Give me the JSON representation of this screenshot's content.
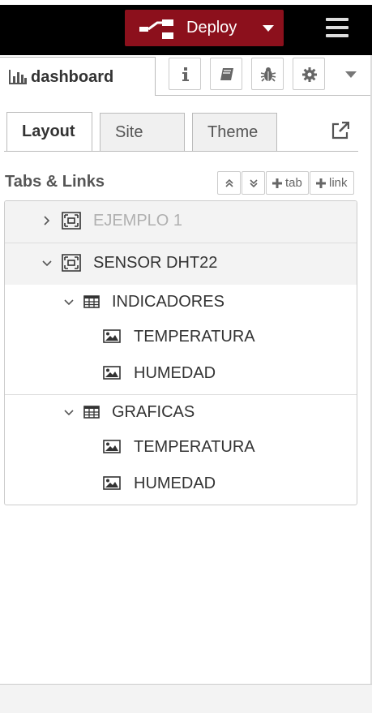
{
  "topbar": {
    "deploy_label": "Deploy",
    "icons": [
      "deploy-flow-icon",
      "chevron-down-icon",
      "menu-icon"
    ],
    "colors": {
      "background": "#000000",
      "deploy": "#8c101c"
    }
  },
  "sidebar_header": {
    "title": "dashboard",
    "icons": [
      "bar-chart-icon",
      "info-icon",
      "book-icon",
      "bug-icon",
      "gear-icon",
      "chevron-down-icon"
    ]
  },
  "tabs": [
    {
      "label": "Layout",
      "active": true
    },
    {
      "label": "Site",
      "active": false
    },
    {
      "label": "Theme",
      "active": false
    }
  ],
  "section": {
    "title": "Tabs & Links",
    "add_tab_label": "tab",
    "add_link_label": "link"
  },
  "tree": {
    "tabs": [
      {
        "label": "EJEMPLO 1",
        "collapsed": true,
        "disabled": true
      },
      {
        "label": "SENSOR DHT22",
        "collapsed": false
      }
    ],
    "groups": [
      {
        "label": "INDICADORES",
        "widgets": [
          "TEMPERATURA",
          "HUMEDAD"
        ]
      },
      {
        "label": "GRAFICAS",
        "widgets": [
          "TEMPERATURA",
          "HUMEDAD"
        ]
      }
    ]
  }
}
